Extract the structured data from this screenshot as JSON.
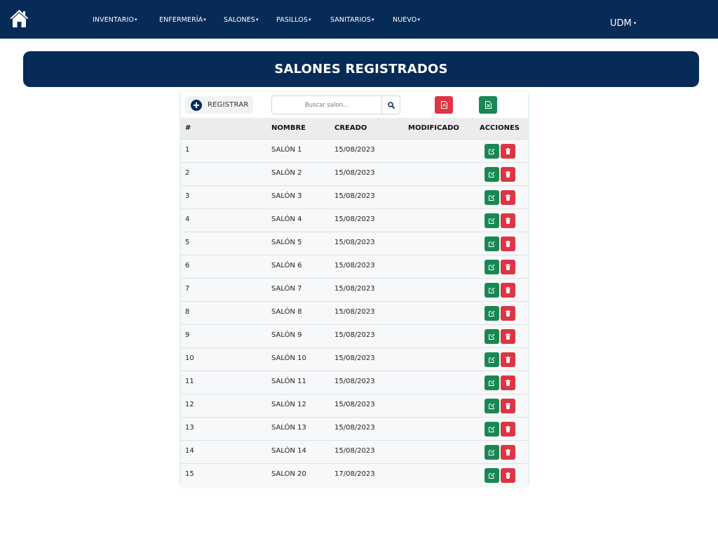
{
  "nav": {
    "items": [
      {
        "label": "INVENTARIO"
      },
      {
        "label": "ENFERMERÍA"
      },
      {
        "label": "SALONES"
      },
      {
        "label": "PASILLOS"
      },
      {
        "label": "SANITARIOS"
      },
      {
        "label": "NUEVO"
      }
    ],
    "user": "UDM",
    "caret": "▾"
  },
  "page": {
    "title": "SALONES REGISTRADOS"
  },
  "toolbar": {
    "register_label": "REGISTRAR",
    "search_placeholder": "Buscar salon..."
  },
  "table": {
    "headers": {
      "id": "#",
      "name": "NOMBRE",
      "created": "CREADO",
      "modified": "MODIFICADO",
      "actions": "ACCIONES"
    },
    "rows": [
      {
        "id": "1",
        "name": "SALÓN 1",
        "created": "15/08/2023",
        "modified": ""
      },
      {
        "id": "2",
        "name": "SALÓN 2",
        "created": "15/08/2023",
        "modified": ""
      },
      {
        "id": "3",
        "name": "SALÓN 3",
        "created": "15/08/2023",
        "modified": ""
      },
      {
        "id": "4",
        "name": "SALÓN 4",
        "created": "15/08/2023",
        "modified": ""
      },
      {
        "id": "5",
        "name": "SALÓN 5",
        "created": "15/08/2023",
        "modified": ""
      },
      {
        "id": "6",
        "name": "SALÓN 6",
        "created": "15/08/2023",
        "modified": ""
      },
      {
        "id": "7",
        "name": "SALÓN 7",
        "created": "15/08/2023",
        "modified": ""
      },
      {
        "id": "8",
        "name": "SALÓN 8",
        "created": "15/08/2023",
        "modified": ""
      },
      {
        "id": "9",
        "name": "SALÓN 9",
        "created": "15/08/2023",
        "modified": ""
      },
      {
        "id": "10",
        "name": "SALÓN 10",
        "created": "15/08/2023",
        "modified": ""
      },
      {
        "id": "11",
        "name": "SALÓN 11",
        "created": "15/08/2023",
        "modified": ""
      },
      {
        "id": "12",
        "name": "SALÓN 12",
        "created": "15/08/2023",
        "modified": ""
      },
      {
        "id": "13",
        "name": "SALÓN 13",
        "created": "15/08/2023",
        "modified": ""
      },
      {
        "id": "14",
        "name": "SALÓN 14",
        "created": "15/08/2023",
        "modified": ""
      },
      {
        "id": "15",
        "name": "SALON 20",
        "created": "17/08/2023",
        "modified": ""
      }
    ]
  },
  "colors": {
    "navy": "#062b57",
    "edit": "#198754",
    "delete": "#dc3545"
  },
  "icons": {
    "home": "home-icon",
    "register": "plus-circle-icon",
    "search": "search-icon",
    "pdf": "file-pdf-icon",
    "excel": "file-excel-icon",
    "edit": "edit-icon",
    "delete": "trash-icon"
  }
}
